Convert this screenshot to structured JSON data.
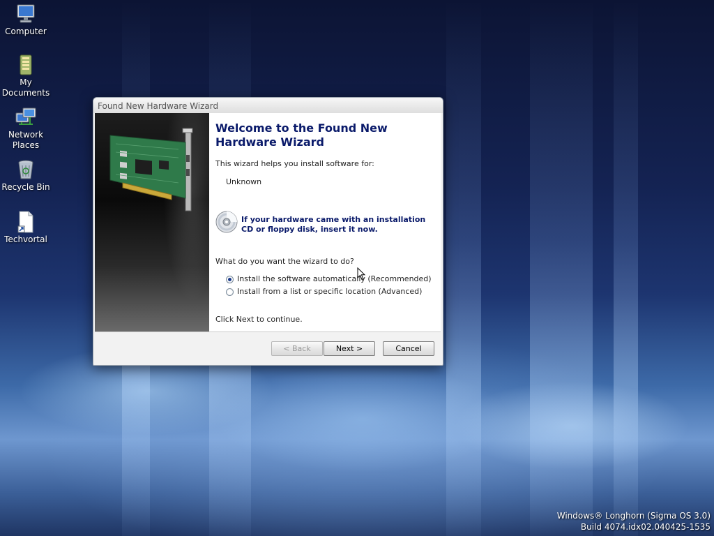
{
  "desktop": {
    "icons": [
      {
        "label": "Computer",
        "icon": "computer-icon"
      },
      {
        "label": "My Documents",
        "icon": "documents-folder-icon"
      },
      {
        "label": "Network Places",
        "icon": "network-icon"
      },
      {
        "label": "Recycle Bin",
        "icon": "recycle-bin-icon"
      },
      {
        "label": "Techvortal",
        "icon": "file-shortcut-icon"
      }
    ],
    "watermark": {
      "line1": "Windows® Longhorn (Sigma OS 3.0)",
      "line2": "Build 4074.idx02.040425-1535"
    }
  },
  "wizard": {
    "window_title": "Found New Hardware Wizard",
    "heading": "Welcome to the Found New Hardware Wizard",
    "intro": "This wizard helps you install software for:",
    "device": "Unknown",
    "cd_note": "If your hardware came with an installation CD or floppy disk, insert it now.",
    "question": "What do you want the wizard to do?",
    "options": [
      {
        "label": "Install the software automatically (Recommended)",
        "selected": true
      },
      {
        "label": "Install from a list or specific location (Advanced)",
        "selected": false
      }
    ],
    "continue_text": "Click Next to continue.",
    "buttons": {
      "back": "< Back",
      "next": "Next >",
      "cancel": "Cancel"
    },
    "side_image_icon": "network-card-icon",
    "cd_icon": "cd-disc-icon"
  },
  "colors": {
    "heading": "#0a1a6a",
    "desktop_top": "#0c1434",
    "desktop_glow": "#6e97cf"
  }
}
